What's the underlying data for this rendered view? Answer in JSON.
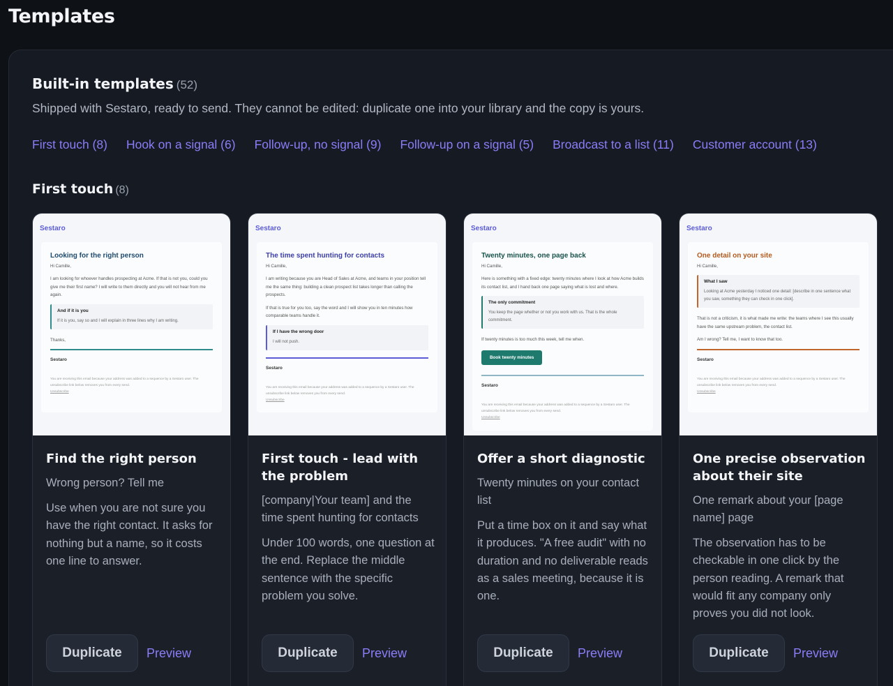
{
  "page": {
    "title": "Templates"
  },
  "section": {
    "title": "Built-in templates",
    "count": "(52)",
    "description": "Shipped with Sestaro, ready to send. They cannot be edited: duplicate one into your library and the copy is yours."
  },
  "categories": [
    "First touch (8)",
    "Hook on a signal (6)",
    "Follow-up, no signal (9)",
    "Follow-up on a signal (5)",
    "Broadcast to a list (11)",
    "Customer account (13)"
  ],
  "group": {
    "title": "First touch",
    "count": "(8)"
  },
  "colors": {
    "accent": "#8b7cf8",
    "card1_accent": "#2f8b8b",
    "card2_accent": "#5b5bd6",
    "card3_accent": "#1f7a6e",
    "card4_accent": "#c0652c"
  },
  "cards": [
    {
      "title": "Find the right person",
      "subject": "Wrong person? Tell me",
      "description": "Use when you are not sure you have the right contact. It asks for nothing but a name, so it costs one line to answer.",
      "duplicate_label": "Duplicate",
      "preview_label": "Preview",
      "email": {
        "brand": "Sestaro",
        "subject": "Looking for the right person",
        "greeting": "Hi Camille,",
        "para1": "I am looking for whoever handles prospecting at Acme. If that is not you, could you give me their first name? I will write to them directly and you will not hear from me again.",
        "callout_title": "And if it is you",
        "callout_text": "If it is you, say so and I will explain in three lines why I am writing.",
        "closing": "Thanks,",
        "signature": "Sestaro",
        "footer": "You are receiving this email because your address was added to a sequence by a Sestaro user. The unsubscribe link below removes you from every send.",
        "unsubscribe": "Unsubscribe"
      }
    },
    {
      "title": "First touch - lead with the problem",
      "subject": "[company|Your team] and the time spent hunting for contacts",
      "description": "Under 100 words, one question at the end. Replace the middle sentence with the specific problem you solve.",
      "duplicate_label": "Duplicate",
      "preview_label": "Preview",
      "email": {
        "brand": "Sestaro",
        "subject": "The time spent hunting for contacts",
        "greeting": "Hi Camille,",
        "para1": "I am writing because you are Head of Sales at Acme, and teams in your position tell me the same thing: building a clean prospect list takes longer than calling the prospects.",
        "para2": "If that is true for you too, say the word and I will show you in ten minutes how comparable teams handle it.",
        "callout_title": "If I have the wrong door",
        "callout_text": "I will not push.",
        "signature": "Sestaro",
        "footer": "You are receiving this email because your address was added to a sequence by a Sestaro user. The unsubscribe link below removes you from every send.",
        "unsubscribe": "Unsubscribe"
      }
    },
    {
      "title": "Offer a short diagnostic",
      "subject": "Twenty minutes on your contact list",
      "description": "Put a time box on it and say what it produces. \"A free audit\" with no duration and no deliverable reads as a sales meeting, because it is one.",
      "duplicate_label": "Duplicate",
      "preview_label": "Preview",
      "email": {
        "brand": "Sestaro",
        "subject": "Twenty minutes, one page back",
        "greeting": "Hi Camille,",
        "para1": "Here is something with a fixed edge: twenty minutes where I look at how Acme builds its contact list, and I hand back one page saying what is lost and where.",
        "callout_title": "The only commitment",
        "callout_text": "You keep the page whether or not you work with us. That is the whole commitment.",
        "para2": "If twenty minutes is too much this week, tell me when.",
        "cta": "Book twenty minutes",
        "signature": "Sestaro",
        "footer": "You are receiving this email because your address was added to a sequence by a Sestaro user. The unsubscribe link below removes you from every send.",
        "unsubscribe": "Unsubscribe"
      }
    },
    {
      "title": "One precise observation about their site",
      "subject": "One remark about your [page name] page",
      "description": "The observation has to be checkable in one click by the person reading. A remark that would fit any company only proves you did not look.",
      "duplicate_label": "Duplicate",
      "preview_label": "Preview",
      "email": {
        "brand": "Sestaro",
        "subject": "One detail on your site",
        "greeting": "Hi Camille,",
        "callout_title": "What I saw",
        "callout_text": "Looking at Acme yesterday I noticed one detail: [describe in one sentence what you saw, something they can check in one click].",
        "para1": "That is not a criticism, it is what made me write: the teams where I see this usually have the same upstream problem, the contact list.",
        "para2": "Am I wrong? Tell me, I want to know that too.",
        "signature": "Sestaro",
        "footer": "You are receiving this email because your address was added to a sequence by a Sestaro user. The unsubscribe link below removes you from every send.",
        "unsubscribe": "Unsubscribe"
      }
    }
  ]
}
